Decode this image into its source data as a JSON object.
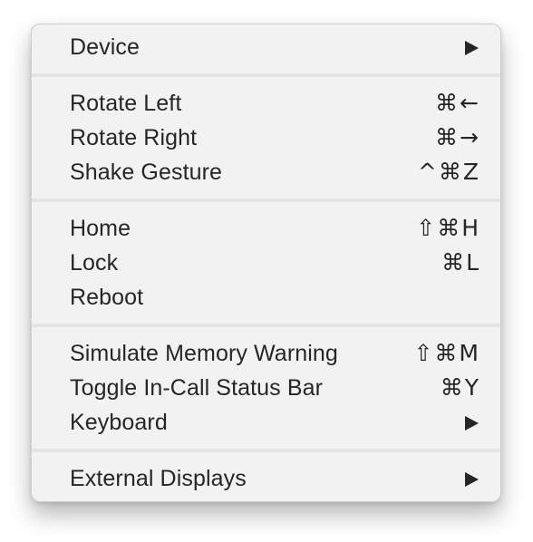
{
  "menu": {
    "groups": [
      {
        "items": [
          {
            "label": "Device",
            "shortcut": "",
            "submenu": true
          }
        ]
      },
      {
        "items": [
          {
            "label": "Rotate Left",
            "shortcut": "⌘←",
            "submenu": false
          },
          {
            "label": "Rotate Right",
            "shortcut": "⌘→",
            "submenu": false
          },
          {
            "label": "Shake Gesture",
            "shortcut": "^⌘Z",
            "submenu": false
          }
        ]
      },
      {
        "items": [
          {
            "label": "Home",
            "shortcut": "⇧⌘H",
            "submenu": false
          },
          {
            "label": "Lock",
            "shortcut": "⌘L",
            "submenu": false
          },
          {
            "label": "Reboot",
            "shortcut": "",
            "submenu": false
          }
        ]
      },
      {
        "items": [
          {
            "label": "Simulate Memory Warning",
            "shortcut": "⇧⌘M",
            "submenu": false
          },
          {
            "label": "Toggle In-Call Status Bar",
            "shortcut": "⌘Y",
            "submenu": false
          },
          {
            "label": "Keyboard",
            "shortcut": "",
            "submenu": true
          }
        ]
      },
      {
        "items": [
          {
            "label": "External Displays",
            "shortcut": "",
            "submenu": true
          }
        ]
      }
    ],
    "submenu_icon": "triangle-right-icon"
  }
}
